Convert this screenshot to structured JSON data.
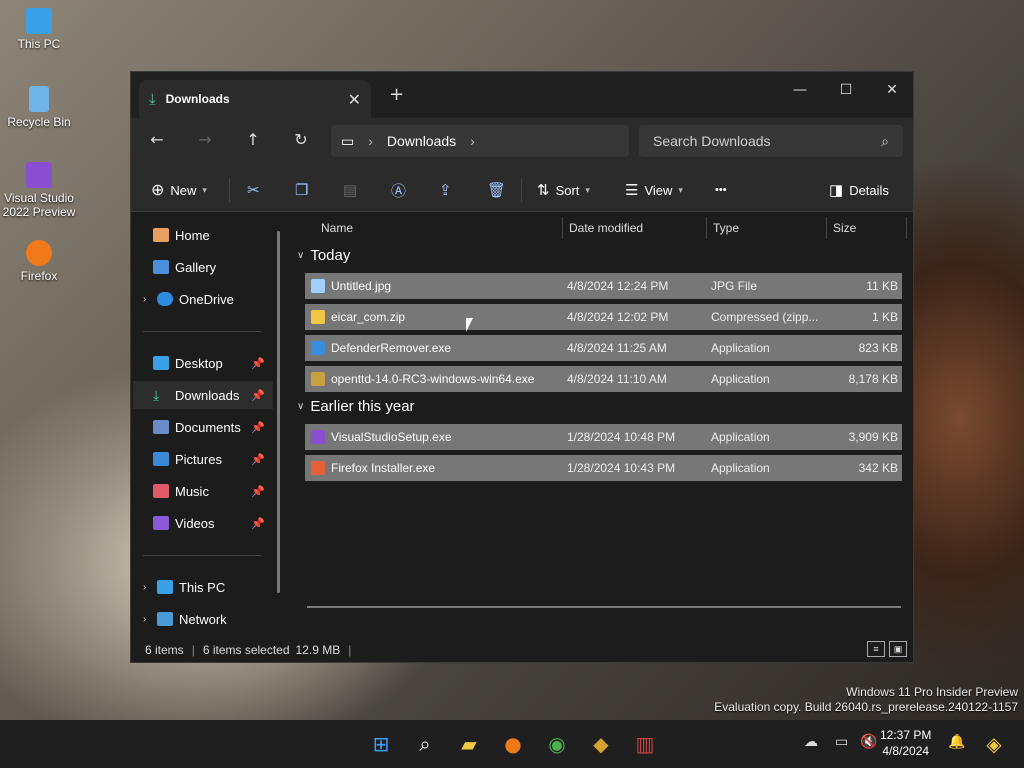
{
  "desktop": {
    "icons": [
      {
        "label": "This PC",
        "color": "#3aa0e8"
      },
      {
        "label": "Recycle Bin",
        "color": "#6fb4e6"
      },
      {
        "label": "Visual Studio 2022 Preview",
        "color": "#8a4fd0"
      },
      {
        "label": "Firefox",
        "color": "#f07a1a"
      }
    ],
    "watermark_line1": "Windows 11 Pro Insider Preview",
    "watermark_line2": "Evaluation copy. Build 26040.rs_prerelease.240122-1157"
  },
  "window": {
    "tab_title": "Downloads",
    "tab_close": "✕",
    "new_tab": "+",
    "controls": {
      "minimize": "—",
      "maximize": "☐",
      "close": "✕"
    },
    "nav": {
      "back": "←",
      "forward": "→",
      "up": "↑",
      "refresh": "↻"
    },
    "address": {
      "root_icon": "▭",
      "sep": "›",
      "folder": "Downloads",
      "trail": "›"
    },
    "search": {
      "placeholder": "Search Downloads",
      "icon": "⌕"
    },
    "toolbar": {
      "new_label": "New",
      "sort_label": "Sort",
      "view_label": "View",
      "more": "•••",
      "details_label": "Details"
    },
    "sidebar": {
      "home": "Home",
      "gallery": "Gallery",
      "onedrive": "OneDrive",
      "desktop": "Desktop",
      "downloads": "Downloads",
      "documents": "Documents",
      "pictures": "Pictures",
      "music": "Music",
      "videos": "Videos",
      "thispc": "This PC",
      "network": "Network"
    },
    "columns": {
      "name": "Name",
      "date": "Date modified",
      "type": "Type",
      "size": "Size"
    },
    "groups": {
      "today": "Today",
      "earlier": "Earlier this year"
    },
    "files": [
      {
        "name": "Untitled.jpg",
        "date": "4/8/2024 12:24 PM",
        "type": "JPG File",
        "size": "11 KB",
        "color": "#9fd0ff"
      },
      {
        "name": "eicar_com.zip",
        "date": "4/8/2024 12:02 PM",
        "type": "Compressed (zipp...",
        "size": "1 KB",
        "color": "#f2c744"
      },
      {
        "name": "DefenderRemover.exe",
        "date": "4/8/2024 11:25 AM",
        "type": "Application",
        "size": "823 KB",
        "color": "#3b8de0"
      },
      {
        "name": "openttd-14.0-RC3-windows-win64.exe",
        "date": "4/8/2024 11:10 AM",
        "type": "Application",
        "size": "8,178 KB",
        "color": "#c8a040"
      },
      {
        "name": "VisualStudioSetup.exe",
        "date": "1/28/2024 10:48 PM",
        "type": "Application",
        "size": "3,909 KB",
        "color": "#8a4fd0"
      },
      {
        "name": "Firefox Installer.exe",
        "date": "1/28/2024 10:43 PM",
        "type": "Application",
        "size": "342 KB",
        "color": "#e8603a"
      }
    ],
    "status": {
      "count": "6 items",
      "selected": "6 items selected",
      "size": "12.9 MB",
      "bar": "|"
    }
  },
  "taskbar": {
    "time": "12:37 PM",
    "date": "4/8/2024"
  }
}
